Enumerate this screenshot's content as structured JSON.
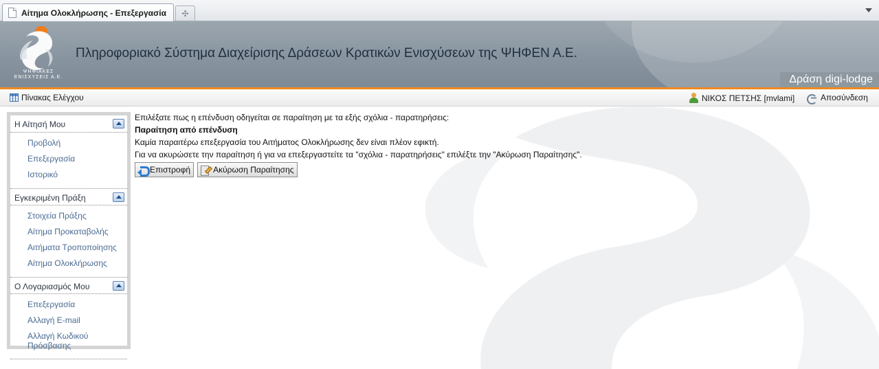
{
  "browser": {
    "tab_title": "Αίτημα Ολοκλήρωσης - Επεξεργασία",
    "new_tab_icon": "plus-icon"
  },
  "header": {
    "logo_caption_line1": "ΨΗΦΙΑΚΕΣ",
    "logo_caption_line2": "ΕΝΙΣΧΥΣΕΙΣ Α.Ε.",
    "site_title": "Πληροφοριακό Σύστημα Διαχείρισης Δράσεων Κρατικών Ενισχύσεων της ΨΗΦΕΝ Α.Ε.",
    "action_name": "Δράση digi-lodge",
    "accent_color": "#ef8a1e"
  },
  "toolbar": {
    "dashboard_label": "Πίνακας Ελέγχου",
    "user_label": "ΝΙΚΟΣ ΠΕΤΣΗΣ [mvlami]",
    "logout_label": "Αποσύνδεση"
  },
  "sidebar": {
    "sections": [
      {
        "title": "Η Αίτησή Μου",
        "items": [
          "Προβολή",
          "Επεξεργασία",
          "Ιστορικό"
        ]
      },
      {
        "title": "Εγκεκριμένη Πράξη",
        "items": [
          "Στοιχεία Πράξης",
          "Αίτημα Προκαταβολής",
          "Αιτήματα Τροποποίησης",
          "Αίτημα Ολοκλήρωσης"
        ]
      },
      {
        "title": "Ο Λογαριασμός Μου",
        "items": [
          "Επεξεργασία",
          "Αλλαγή E-mail",
          "Αλλαγή Κωδικού Πρόσβασης"
        ]
      }
    ]
  },
  "main": {
    "intro": "Επιλέξατε πως η επένδυση οδηγείται σε παραίτηση με τα εξής σχόλια - παρατηρήσεις:",
    "status": "Παραίτηση από επένδυση",
    "no_further": "Καμία παραιτέρω επεξεργασία του Αιτήματος Ολοκλήρωσης δεν είναι πλέον εφικτή.",
    "instructions": "Για να ακυρώσετε την παραίτηση ή για να επεξεργαστείτε τα \"σχόλια - παρατηρήσεις\" επιλέξτε την \"Ακύρωση Παραίτησης\".",
    "back_button": "Επιστροφή",
    "cancel_resignation_button": "Ακύρωση Παραίτησης"
  }
}
